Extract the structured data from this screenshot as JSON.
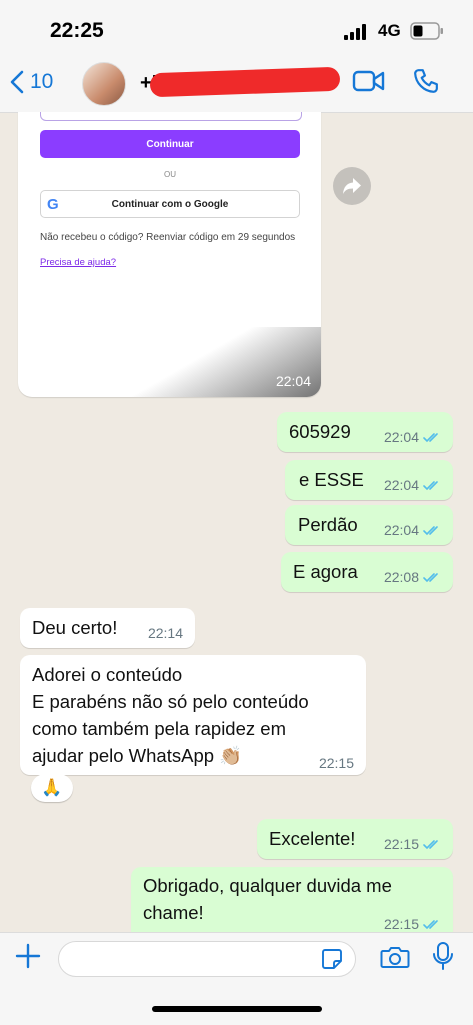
{
  "status_bar": {
    "time": "22:25",
    "network": "4G"
  },
  "header": {
    "back_count": "10",
    "contact_name": "+5"
  },
  "shared_screenshot": {
    "continue_button": "Continuar",
    "divider": "OU",
    "google_button": "Continuar com o Google",
    "google_letter": "G",
    "code_text": "Não recebeu o código? Reenviar código em 29 segundos",
    "help_link": "Precisa de ajuda?",
    "time": "22:04"
  },
  "messages": [
    {
      "direction": "out",
      "text": "605929",
      "time": "22:04"
    },
    {
      "direction": "out",
      "text": "e ESSE",
      "time": "22:04"
    },
    {
      "direction": "out",
      "text": "Perdão",
      "time": "22:04"
    },
    {
      "direction": "out",
      "text": "E agora",
      "time": "22:08"
    },
    {
      "direction": "in",
      "text": "Deu certo!",
      "time": "22:14"
    },
    {
      "direction": "in",
      "text_lines": [
        "Adorei o conteúdo",
        "E parabéns não só pelo conteúdo",
        "como também pela rapidez em",
        "ajudar pelo WhatsApp 👏🏼"
      ],
      "time": "22:15",
      "reaction": "🙏"
    },
    {
      "direction": "out",
      "text": "Excelente!",
      "time": "22:15"
    },
    {
      "direction": "out",
      "text_lines": [
        "Obrigado, qualquer duvida me",
        "chame!"
      ],
      "time": "22:15"
    }
  ],
  "composer": {
    "placeholder": ""
  },
  "colors": {
    "accent": "#1577d6",
    "outgoing_bubble": "#d9fdd3",
    "read_tick": "#53bdeb",
    "background": "#efeae2",
    "redaction": "#ef2a2a"
  }
}
